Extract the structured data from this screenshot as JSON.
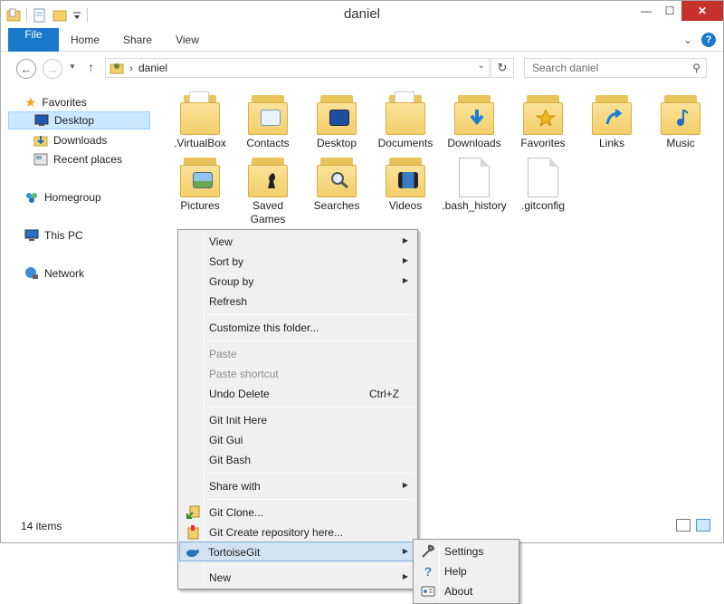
{
  "window": {
    "title": "daniel",
    "minimize_glyph": "—",
    "maximize_glyph": "☐",
    "close_glyph": "✕"
  },
  "ribbon": {
    "tabs": [
      "File",
      "Home",
      "Share",
      "View"
    ],
    "accent": "#1979ca",
    "expand_glyph": "⌄",
    "help_glyph": "?"
  },
  "address": {
    "back_glyph": "←",
    "forward_glyph": "→",
    "up_glyph": "↑",
    "path": "daniel",
    "separator_glyph": "›",
    "dropdown_glyph": "⌄",
    "refresh_glyph": "↻",
    "search_placeholder": "Search daniel",
    "search_glyph": "⚲"
  },
  "navpane": {
    "favorites": "Favorites",
    "desktop": "Desktop",
    "downloads": "Downloads",
    "recent": "Recent places",
    "homegroup": "Homegroup",
    "thispc": "This PC",
    "network": "Network"
  },
  "files": [
    {
      "name": ".VirtualBox",
      "kind": "folder",
      "emblem": "paper"
    },
    {
      "name": "Contacts",
      "kind": "folder",
      "emblem": "contacts-icon"
    },
    {
      "name": "Desktop",
      "kind": "folder",
      "emblem": "desktop-icon"
    },
    {
      "name": "Documents",
      "kind": "folder",
      "emblem": "paper"
    },
    {
      "name": "Downloads",
      "kind": "folder",
      "emblem": "download-arrow-icon"
    },
    {
      "name": "Favorites",
      "kind": "folder",
      "emblem": "star-icon"
    },
    {
      "name": "Links",
      "kind": "folder",
      "emblem": "link-arrow-icon"
    },
    {
      "name": "Music",
      "kind": "folder",
      "emblem": "music-note-icon"
    },
    {
      "name": "Pictures",
      "kind": "folder",
      "emblem": "landscape-icon"
    },
    {
      "name": "Saved Games",
      "kind": "folder",
      "emblem": "chess-piece-icon"
    },
    {
      "name": "Searches",
      "kind": "folder",
      "emblem": "magnifier-icon"
    },
    {
      "name": "Videos",
      "kind": "folder",
      "emblem": "film-icon"
    },
    {
      "name": ".bash_history",
      "kind": "file"
    },
    {
      "name": ".gitconfig",
      "kind": "file"
    }
  ],
  "status": {
    "item_count": "14 items"
  },
  "context_menu": {
    "view": "View",
    "sort_by": "Sort by",
    "group_by": "Group by",
    "refresh": "Refresh",
    "customize": "Customize this folder...",
    "paste": "Paste",
    "paste_shortcut": "Paste shortcut",
    "undo_delete": "Undo Delete",
    "undo_shortcut": "Ctrl+Z",
    "git_init": "Git Init Here",
    "git_gui": "Git Gui",
    "git_bash": "Git Bash",
    "share_with": "Share with",
    "git_clone": "Git Clone...",
    "git_create": "Git Create repository here...",
    "tortoisegit": "TortoiseGit",
    "new": "New",
    "submenu_glyph": "▶"
  },
  "submenu": {
    "settings": "Settings",
    "help": "Help",
    "about": "About"
  }
}
